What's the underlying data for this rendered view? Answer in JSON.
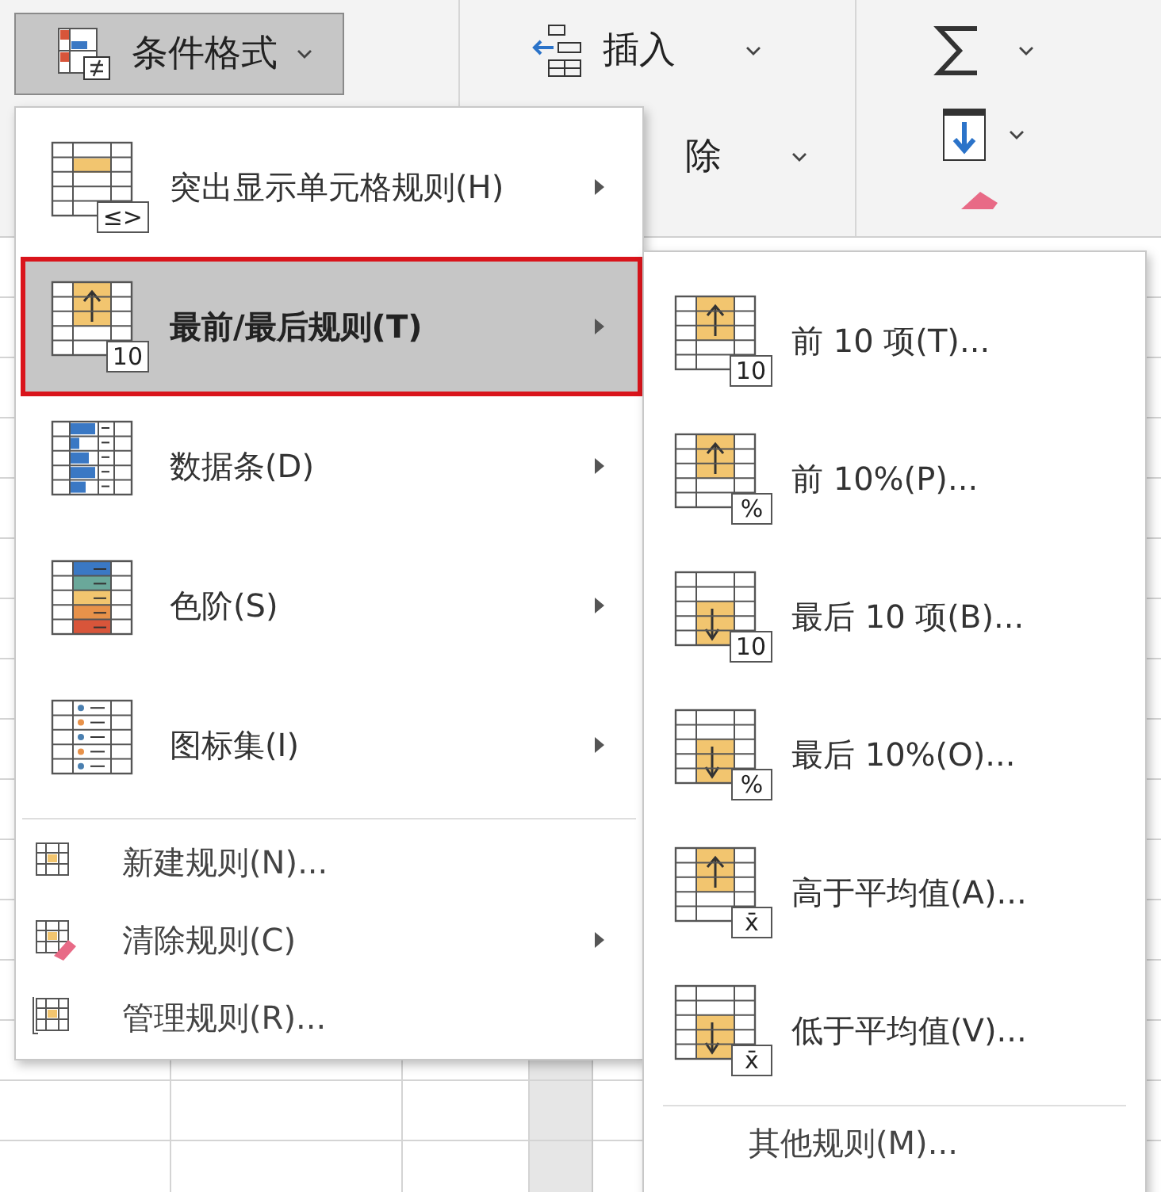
{
  "ribbon": {
    "conditional_formatting": {
      "label": "条件格式",
      "selected": true
    },
    "insert": {
      "label": "插入"
    },
    "delete": {
      "label": "除"
    }
  },
  "menu": {
    "items": [
      {
        "kind": "large",
        "badge": "≤>",
        "label": "突出显示单元格规则(H)",
        "selected": false,
        "has_submenu": true
      },
      {
        "kind": "large",
        "badge": "10",
        "label": "最前/最后规则(T)",
        "selected": true,
        "has_submenu": true
      },
      {
        "kind": "large",
        "label": "数据条(D)",
        "selected": false,
        "has_submenu": true
      },
      {
        "kind": "large",
        "label": "色阶(S)",
        "selected": false,
        "has_submenu": true
      },
      {
        "kind": "large",
        "label": "图标集(I)",
        "selected": false,
        "has_submenu": true
      },
      {
        "kind": "small",
        "label": "新建规则(N)...",
        "selected": false,
        "has_submenu": false
      },
      {
        "kind": "small",
        "label": "清除规则(C)",
        "selected": false,
        "has_submenu": true
      },
      {
        "kind": "small",
        "label": "管理规则(R)...",
        "selected": false,
        "has_submenu": false
      }
    ]
  },
  "submenu": {
    "items": [
      {
        "badge": "10",
        "label": "前 10 项(T)..."
      },
      {
        "badge": "%",
        "label": "前 10%(P)..."
      },
      {
        "badge": "10",
        "label": "最后 10 项(B)..."
      },
      {
        "badge": "%",
        "label": "最后 10%(O)..."
      },
      {
        "badge": "x̄",
        "label": "高于平均值(A)..."
      },
      {
        "badge": "x̄",
        "label": "低于平均值(V)..."
      }
    ],
    "footer": {
      "label": "其他规则(M)..."
    }
  }
}
